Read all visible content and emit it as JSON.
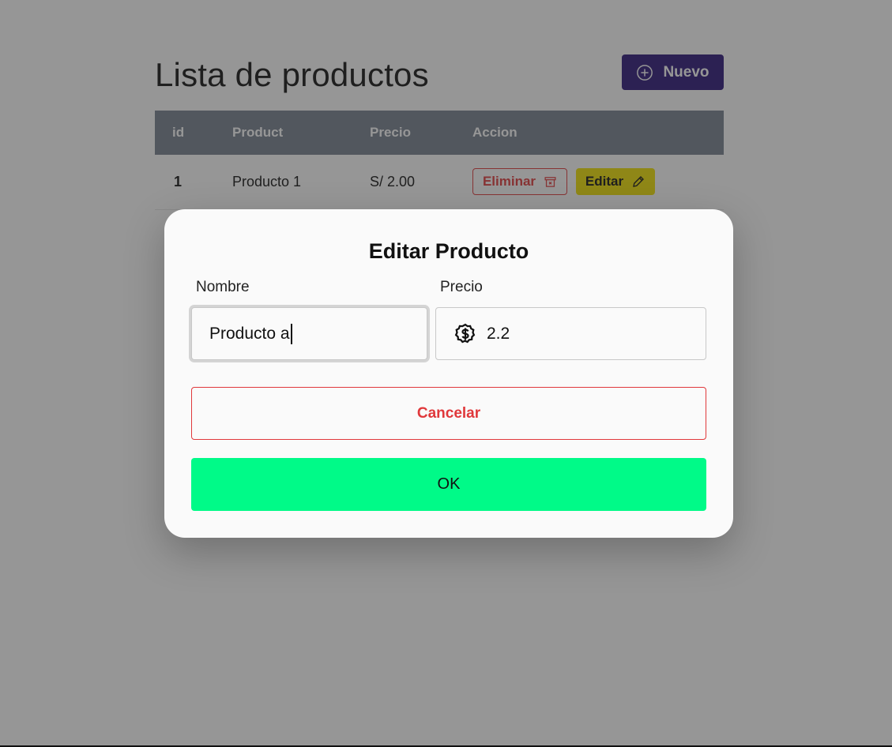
{
  "page": {
    "title": "Lista de productos",
    "new_button_label": "Nuevo"
  },
  "table": {
    "headers": [
      "id",
      "Product",
      "Precio",
      "Accion"
    ],
    "rows": [
      {
        "id": "1",
        "product": "Producto 1",
        "price": "S/ 2.00",
        "delete_label": "Eliminar",
        "edit_label": "Editar"
      }
    ]
  },
  "modal": {
    "title": "Editar Producto",
    "name_label": "Nombre",
    "name_value": "Producto a",
    "price_label": "Precio",
    "price_value": "2.2",
    "price_icon": "dollar-badge-icon",
    "cancel_label": "Cancelar",
    "ok_label": "OK"
  },
  "colors": {
    "new_button": "#2a1478",
    "table_header": "#76808f",
    "delete": "#e0383b",
    "edit": "#f0e000",
    "ok": "#00fa88"
  }
}
